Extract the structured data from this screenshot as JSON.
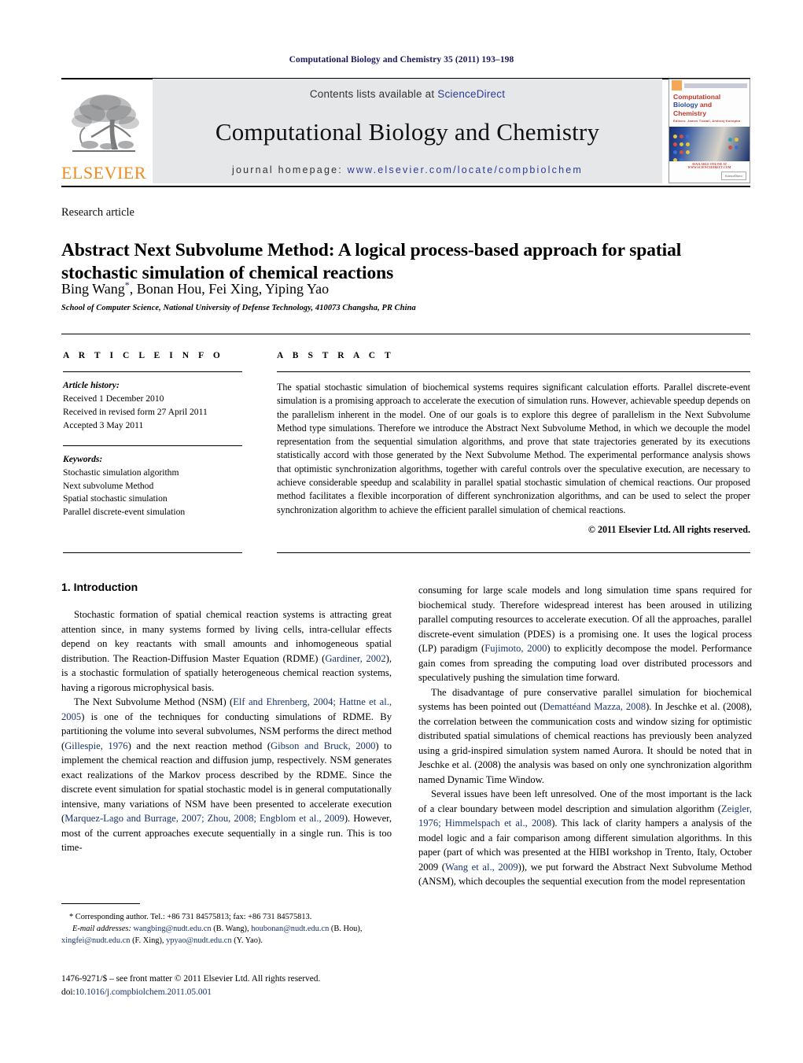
{
  "running_head": "Computational Biology and Chemistry 35 (2011) 193–198",
  "masthead": {
    "publisher_name": "ELSEVIER",
    "contents_prefix": "Contents lists available at ",
    "contents_link": "ScienceDirect",
    "journal_title": "Computational Biology and Chemistry",
    "homepage_prefix": "journal homepage: ",
    "homepage_url": "www.elsevier.com/locate/compbiolchem",
    "cover": {
      "line1": "Computational",
      "line2a": "Biology",
      "line2b": "and",
      "line3": "Chemistry",
      "editors": "Editors: James Tisdall, Andrzej Konopka",
      "footer": "AVAILABLE ONLINE AT WWW.SCIENCEDIRECT.COM",
      "badge": "ScienceDirect"
    }
  },
  "article": {
    "type_label": "Research article",
    "title": "Abstract Next Subvolume Method: A logical process-based approach for spatial stochastic simulation of chemical reactions",
    "authors": "Bing Wang*, Bonan Hou, Fei Xing, Yiping Yao",
    "affiliation": "School of Computer Science, National University of Defense Technology, 410073 Changsha, PR China"
  },
  "article_info": {
    "label": "A R T I C L E  I N F O",
    "history_label": "Article history:",
    "history": [
      "Received 1 December 2010",
      "Received in revised form 27 April 2011",
      "Accepted 3 May 2011"
    ],
    "keywords_label": "Keywords:",
    "keywords": [
      "Stochastic simulation algorithm",
      "Next subvolume Method",
      "Spatial stochastic simulation",
      "Parallel discrete-event simulation"
    ]
  },
  "abstract": {
    "label": "A B S T R A C T",
    "text": "The spatial stochastic simulation of biochemical systems requires significant calculation efforts. Parallel discrete-event simulation is a promising approach to accelerate the execution of simulation runs. However, achievable speedup depends on the parallelism inherent in the model. One of our goals is to explore this degree of parallelism in the Next Subvolume Method type simulations. Therefore we introduce the Abstract Next Subvolume Method, in which we decouple the model representation from the sequential simulation algorithms, and prove that state trajectories generated by its executions statistically accord with those generated by the Next Subvolume Method. The experimental performance analysis shows that optimistic synchronization algorithms, together with careful controls over the speculative execution, are necessary to achieve considerable speedup and scalability in parallel spatial stochastic simulation of chemical reactions. Our proposed method facilitates a flexible incorporation of different synchronization algorithms, and can be used to select the proper synchronization algorithm to achieve the efficient parallel simulation of chemical reactions.",
    "copyright": "© 2011 Elsevier Ltd. All rights reserved."
  },
  "body": {
    "section_number_title": "1.  Introduction",
    "left_paragraphs": [
      "Stochastic formation of spatial chemical reaction systems is attracting great attention since, in many systems formed by living cells, intra-cellular effects depend on key reactants with small amounts and inhomogeneous spatial distribution. The Reaction-Diffusion Master Equation (RDME) (Gardiner, 2002), is a stochastic formulation of spatially heterogeneous chemical reaction systems, having a rigorous microphysical basis.",
      "The Next Subvolume Method (NSM) (Elf and Ehrenberg, 2004; Hattne et al., 2005) is one of the techniques for conducting simulations of RDME. By partitioning the volume into several subvolumes, NSM performs the direct method (Gillespie, 1976) and the next reaction method (Gibson and Bruck, 2000) to implement the chemical reaction and diffusion jump, respectively. NSM generates exact realizations of the Markov process described by the RDME. Since the discrete event simulation for spatial stochastic model is in general computationally intensive, many variations of NSM have been presented to accelerate execution (Marquez-Lago and Burrage, 2007; Zhou, 2008; Engblom et al., 2009). However, most of the current approaches execute sequentially in a single run. This is too time-"
    ],
    "right_paragraphs": [
      "consuming for large scale models and long simulation time spans required for biochemical study. Therefore widespread interest has been aroused in utilizing parallel computing resources to accelerate execution. Of all the approaches, parallel discrete-event simulation (PDES) is a promising one. It uses the logical process (LP) paradigm (Fujimoto, 2000) to explicitly decompose the model. Performance gain comes from spreading the computing load over distributed processors and speculatively pushing the simulation time forward.",
      "The disadvantage of pure conservative parallel simulation for biochemical systems has been pointed out (Demattéand Mazza, 2008). In Jeschke et al. (2008), the correlation between the communication costs and window sizing for optimistic distributed spatial simulations of chemical reactions has previously been analyzed using a grid-inspired simulation system named Aurora. It should be noted that in Jeschke et al. (2008) the analysis was based on only one synchronization algorithm named Dynamic Time Window.",
      "Several issues have been left unresolved. One of the most important is the lack of a clear boundary between model description and simulation algorithm (Zeigler, 1976; Himmelspach et al., 2008). This lack of clarity hampers a analysis of the model logic and a fair comparison among different simulation algorithms. In this paper (part of which was presented at the HIBI workshop in Trento, Italy, October 2009 (Wang et al., 2009)), we put forward the Abstract Next Subvolume Method (ANSM), which decouples the sequential execution from the model representation"
    ]
  },
  "footnote": {
    "corresponding": "* Corresponding author. Tel.: +86 731 84575813; fax: +86 731 84575813.",
    "email_label": "E-mail addresses:",
    "emails": [
      {
        "address": "wangbing@nudt.edu.cn",
        "owner": "(B. Wang),"
      },
      {
        "address": "houbonan@nudt.edu.cn",
        "owner": "(B. Hou),"
      },
      {
        "address": "xingfei@nudt.edu.cn",
        "owner": "(F. Xing),"
      },
      {
        "address": "ypyao@nudt.edu.cn",
        "owner": "(Y. Yao)."
      }
    ]
  },
  "imprint": {
    "front_matter": "1476-9271/$ – see front matter © 2011 Elsevier Ltd. All rights reserved.",
    "doi_prefix": "doi:",
    "doi": "10.1016/j.compbiolchem.2011.05.001"
  }
}
